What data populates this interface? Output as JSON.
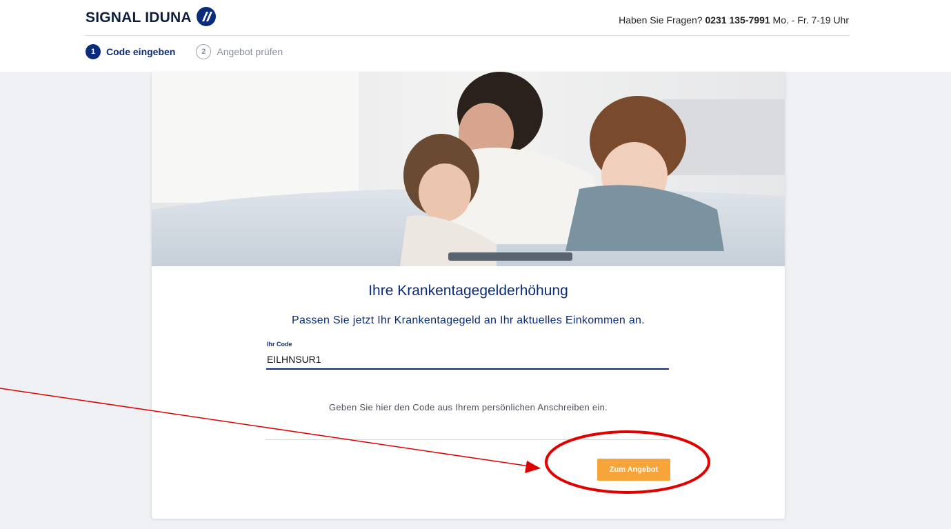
{
  "header": {
    "brand": "SIGNAL IDUNA",
    "contact_prefix": "Haben Sie Fragen?",
    "contact_phone": "0231 135-7991",
    "contact_hours": "Mo. - Fr. 7-19 Uhr"
  },
  "steps": [
    {
      "number": "1",
      "label": "Code eingeben",
      "state": "active"
    },
    {
      "number": "2",
      "label": "Angebot prüfen",
      "state": "inactive"
    }
  ],
  "hero": {
    "icon": "family-photo"
  },
  "main": {
    "title": "Ihre Krankentagegelderhöhung",
    "subtitle": "Passen Sie jetzt Ihr Krankentagegeld an Ihr aktuelles Einkommen an.",
    "code_field": {
      "label": "Ihr Code",
      "value": "EILHNSUR1"
    },
    "hint": "Geben Sie hier den Code aus Ihrem persönlichen Anschreiben ein.",
    "submit_label": "Zum Angebot"
  },
  "colors": {
    "brand_blue": "#0b2c7a",
    "button_orange": "#f7a43a",
    "annotation_red": "#e00000"
  }
}
